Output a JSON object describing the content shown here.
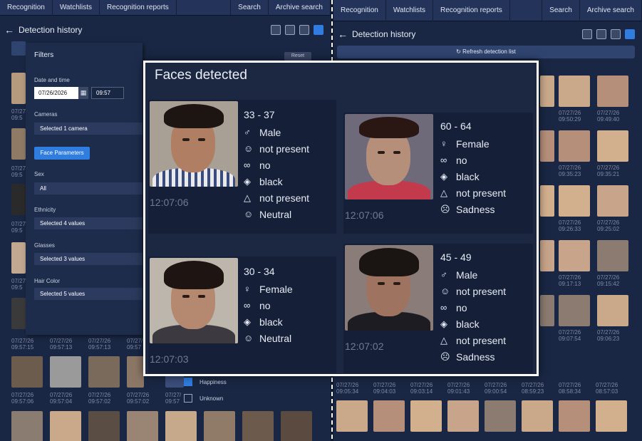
{
  "left_nav": [
    "Recognition",
    "Watchlists",
    "Recognition reports",
    "Search",
    "Archive search"
  ],
  "right_nav": [
    "Recognition",
    "Watchlists",
    "Recognition reports",
    "Search",
    "Archive search"
  ],
  "left_title": "Detection history",
  "right_title": "Detection history",
  "refresh_label": "Refresh detection list",
  "filters": {
    "title": "Filters",
    "reset_label": "Reset",
    "date_label": "Date and time",
    "date_value": "07/26/2026",
    "time_value": "09:57",
    "cameras_label": "Cameras",
    "cameras_value": "Selected 1 camera",
    "face_params_label": "Face Parameters",
    "sex_label": "Sex",
    "sex_value": "All",
    "ethnicity_label": "Ethnicity",
    "ethnicity_value": "Selected 4 values",
    "glasses_label": "Glasses",
    "glasses_value": "Selected 3 values",
    "hair_label": "Hair Color",
    "hair_value": "Selected 5 values"
  },
  "emotion_options": [
    {
      "label": "Happiness",
      "checked": true
    },
    {
      "label": "Unknown",
      "checked": false
    }
  ],
  "overlay": {
    "title": "Faces detected",
    "faces": [
      {
        "age": "33 - 37",
        "sex": "Male",
        "mustache": "not present",
        "glasses": "no",
        "hair": "black",
        "hat": "not present",
        "emotion": "Neutral",
        "time": "12:07:06"
      },
      {
        "age": "60 - 64",
        "sex": "Female",
        "glasses": "no",
        "hair": "black",
        "hat": "not present",
        "emotion": "Sadness",
        "time": "12:07:06"
      },
      {
        "age": "30 - 34",
        "sex": "Female",
        "glasses": "no",
        "hair": "black",
        "emotion": "Neutral",
        "time": "12:07:03"
      },
      {
        "age": "45 - 49",
        "sex": "Male",
        "mustache": "not present",
        "glasses": "no",
        "hair": "black",
        "hat": "not present",
        "emotion": "Sadness",
        "time": "12:07:02"
      }
    ]
  },
  "left_timestamps_row1": [
    "07/27/26\n09:57:15",
    "07/27/26\n09:57:13",
    "07/27/26\n09:57:13",
    "07/27/\n09:57"
  ],
  "left_timestamps_row2": [
    "07/27/26\n09:57:06",
    "07/27/26\n09:57:04",
    "07/27/26\n09:57:02",
    "07/27/26\n09:57:02",
    "07/27/\n09:57"
  ],
  "left_side_ts": [
    "07/27\n09:5",
    "07/27\n09:5",
    "07/27\n09:5",
    "07/27\n09:5",
    "07/27\n09:5"
  ],
  "right_grid_ts": [
    [
      "07/27/26\n09:50:29",
      "07/27/26\n09:49:40"
    ],
    [
      "07/27/26\n09:35:23",
      "07/27/26\n09:35:21"
    ],
    [
      "07/27/26\n09:26:33",
      "07/27/26\n09:25:02"
    ],
    [
      "07/27/26\n09:17:13",
      "07/27/26\n09:15:42"
    ],
    [
      "07/27/26\n09:07:54",
      "07/27/26\n09:06:23"
    ]
  ],
  "right_bottom_ts": [
    "07/27/26\n09:05:34",
    "07/27/26\n09:04:03",
    "07/27/26\n09:03:14",
    "07/27/26\n09:01:43",
    "07/27/26\n09:00:54",
    "07/27/26\n08:59:23",
    "07/27/26\n08:58:34",
    "07/27/26\n08:57:03"
  ],
  "colors": {
    "accent": "#2f7de0",
    "panel": "#1a2744",
    "overlay_border": "#ffffff"
  }
}
